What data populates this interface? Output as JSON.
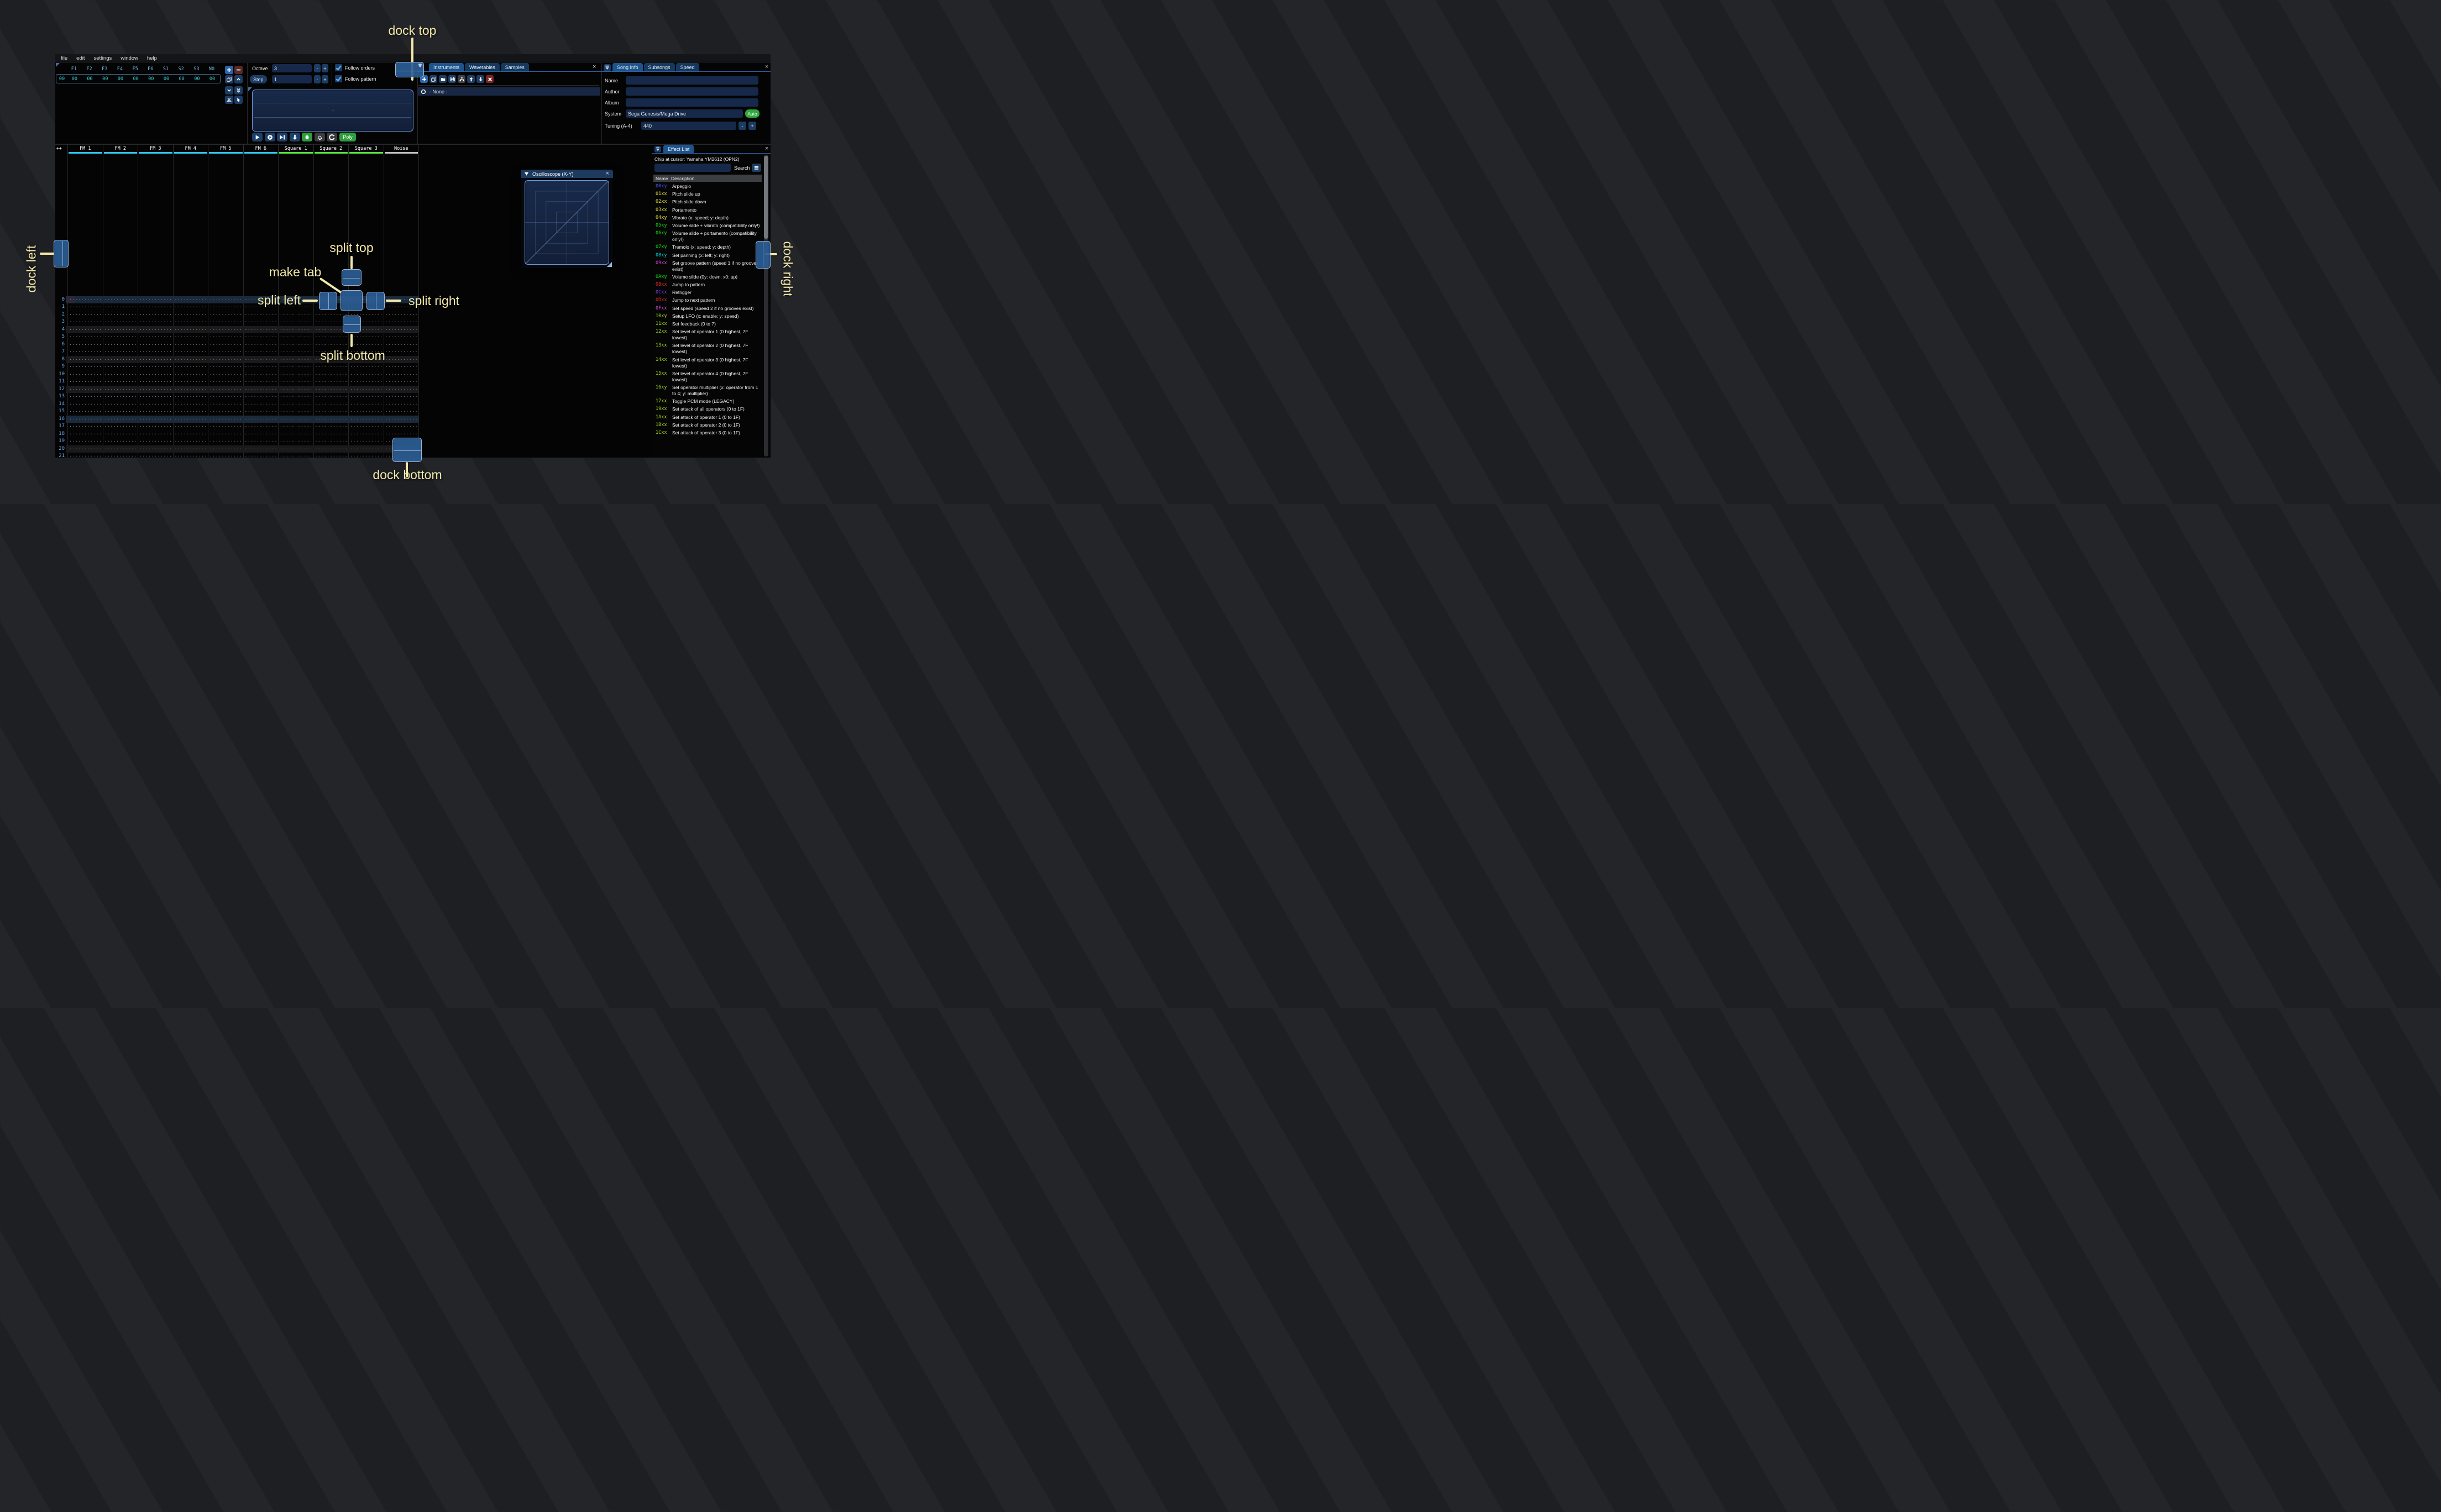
{
  "colors": {
    "accent_yellow": "#f2e8aa",
    "dock_button_blue": "#2d5d95",
    "auto_green": "#2fa83c",
    "poly_green": "#2e9e3e",
    "fm_channel": "#2fc6f2",
    "square_channel": "#58e23e",
    "noise_channel": "#c0c0c0",
    "active_tab": "#1e548c",
    "input_bg": "#16294a"
  },
  "menu": {
    "items": [
      "file",
      "edit",
      "settings",
      "window",
      "help"
    ]
  },
  "orders": {
    "columns": [
      "F1",
      "F2",
      "F3",
      "F4",
      "F5",
      "F6",
      "S1",
      "S2",
      "S3",
      "N0"
    ],
    "row_index": "00",
    "row_values": [
      "00",
      "00",
      "00",
      "00",
      "00",
      "00",
      "00",
      "00",
      "00",
      "00"
    ],
    "buttons": [
      "add-order",
      "remove-order",
      "duplicate-order",
      "move-order-up",
      "move-order-down",
      "duplicate-order-end",
      "deep-clone-order",
      "order-edit-mode"
    ]
  },
  "play_controls": {
    "octave_label": "Octave",
    "octave_value": "3",
    "step_label": "Step",
    "step_value": "1",
    "minus_label": "-",
    "plus_label": "+",
    "follow_orders_label": "Follow orders",
    "follow_pattern_label": "Follow pattern",
    "transport_buttons": [
      "play",
      "play-from-cursor",
      "play-one-row",
      "step-row",
      "edit-record",
      "metronome",
      "repeat-pattern"
    ],
    "poly_label": "Poly"
  },
  "instruments_panel": {
    "tabs": [
      "Instruments",
      "Wavetables",
      "Samples"
    ],
    "active_tab": "Instruments",
    "close_label": "×",
    "toolbar": [
      "add",
      "duplicate",
      "open",
      "save",
      "folder-view",
      "move-up",
      "move-down",
      "delete"
    ],
    "selected_item": "- None -"
  },
  "song_info": {
    "tabs": [
      "Song Info",
      "Subsongs",
      "Speed"
    ],
    "active_tab": "Song Info",
    "close_label": "×",
    "name_label": "Name",
    "name_value": "",
    "author_label": "Author",
    "author_value": "",
    "album_label": "Album",
    "album_value": "",
    "system_label": "System",
    "system_value": "Sega Genesis/Mega Drive",
    "auto_label": "Auto",
    "tuning_label": "Tuning (A-4)",
    "tuning_value": "440",
    "minus_label": "-",
    "plus_label": "+"
  },
  "pattern": {
    "collapse_label": "++",
    "channels": [
      {
        "name": "FM 1",
        "color": "#2fc6f2"
      },
      {
        "name": "FM 2",
        "color": "#2fc6f2"
      },
      {
        "name": "FM 3",
        "color": "#2fc6f2"
      },
      {
        "name": "FM 4",
        "color": "#2fc6f2"
      },
      {
        "name": "FM 5",
        "color": "#2fc6f2"
      },
      {
        "name": "FM 6",
        "color": "#2fc6f2"
      },
      {
        "name": "Square 1",
        "color": "#58e23e"
      },
      {
        "name": "Square 2",
        "color": "#58e23e"
      },
      {
        "name": "Square 3",
        "color": "#58e23e"
      },
      {
        "name": "Noise",
        "color": "#c0c0c0"
      }
    ],
    "row_numbers": [
      0,
      1,
      2,
      3,
      4,
      5,
      6,
      7,
      8,
      9,
      10,
      11,
      12,
      13,
      14,
      15,
      16,
      17,
      18,
      19,
      20,
      21
    ],
    "empty_cell": "············",
    "major_highlight_rows": [
      0,
      16
    ],
    "minor_highlight_rows": [
      4,
      8,
      12,
      20
    ],
    "cursor": {
      "row": 0,
      "channel": 0
    }
  },
  "oscilloscope": {
    "title": "Oscilloscope (X-Y)",
    "close_label": "×"
  },
  "effect_list": {
    "tab_label": "Effect List",
    "close_label": "×",
    "chip_label": "Chip at cursor: Yamaha YM2612 (OPN2)",
    "search_value": "",
    "search_label": "Search",
    "name_header": "Name",
    "description_header": "Description",
    "effects": [
      {
        "name": "00xy",
        "color": "#4a55f2",
        "description": "Arpeggio"
      },
      {
        "name": "01xx",
        "color": "#e8e13c",
        "description": "Pitch slide up"
      },
      {
        "name": "02xx",
        "color": "#e8e13c",
        "description": "Pitch slide down"
      },
      {
        "name": "03xx",
        "color": "#e8e13c",
        "description": "Portamento"
      },
      {
        "name": "04xy",
        "color": "#e8e13c",
        "description": "Vibrato (x: speed; y: depth)"
      },
      {
        "name": "05xy",
        "color": "#15dd15",
        "description": "Volume slide + vibrato (compatibility only!)"
      },
      {
        "name": "06xy",
        "color": "#15dd15",
        "description": "Volume slide + portamento (compatibility only!)"
      },
      {
        "name": "07xy",
        "color": "#15dd15",
        "description": "Tremolo (x: speed; y: depth)"
      },
      {
        "name": "08xy",
        "color": "#00d4d4",
        "description": "Set panning (x: left; y: right)"
      },
      {
        "name": "09xx",
        "color": "#d943d9",
        "description": "Set groove pattern (speed 1 if no grooves exist)"
      },
      {
        "name": "0Axy",
        "color": "#15dd15",
        "description": "Volume slide (0y: down; x0: up)"
      },
      {
        "name": "0Bxx",
        "color": "#d92b2b",
        "description": "Jump to pattern"
      },
      {
        "name": "0Cxx",
        "color": "#7a3bf0",
        "description": "Retrigger"
      },
      {
        "name": "0Dxx",
        "color": "#d92b2b",
        "description": "Jump to next pattern"
      },
      {
        "name": "0Fxx",
        "color": "#d943d9",
        "description": "Set speed (speed 2 if no grooves exist)"
      },
      {
        "name": "10xy",
        "color": "#a3d921",
        "description": "Setup LFO (x: enable; y: speed)"
      },
      {
        "name": "11xx",
        "color": "#a3d921",
        "description": "Set feedback (0 to 7)"
      },
      {
        "name": "12xx",
        "color": "#a3d921",
        "description": "Set level of operator 1 (0 highest, 7F lowest)"
      },
      {
        "name": "13xx",
        "color": "#a3d921",
        "description": "Set level of operator 2 (0 highest, 7F lowest)"
      },
      {
        "name": "14xx",
        "color": "#a3d921",
        "description": "Set level of operator 3 (0 highest, 7F lowest)"
      },
      {
        "name": "15xx",
        "color": "#a3d921",
        "description": "Set level of operator 4 (0 highest, 7F lowest)"
      },
      {
        "name": "16xy",
        "color": "#a3d921",
        "description": "Set operator multiplier (x: operator from 1 to 4; y: multiplier)"
      },
      {
        "name": "17xx",
        "color": "#a3d921",
        "description": "Toggle PCM mode (LEGACY)"
      },
      {
        "name": "19xx",
        "color": "#a3d921",
        "description": "Set attack of all operators (0 to 1F)"
      },
      {
        "name": "1Axx",
        "color": "#a3d921",
        "description": "Set attack of operator 1 (0 to 1F)"
      },
      {
        "name": "1Bxx",
        "color": "#a3d921",
        "description": "Set attack of operator 2 (0 to 1F)"
      },
      {
        "name": "1Cxx",
        "color": "#a3d921",
        "description": "Set attack of operator 3 (0 to 1F)"
      }
    ]
  },
  "dock_overlay": {
    "dock_top": "dock top",
    "dock_left": "dock left",
    "dock_right": "dock right",
    "dock_bottom": "dock bottom",
    "split_top": "split top",
    "split_left": "split left",
    "split_right": "split right",
    "split_bottom": "split bottom",
    "make_tab": "make tab"
  }
}
